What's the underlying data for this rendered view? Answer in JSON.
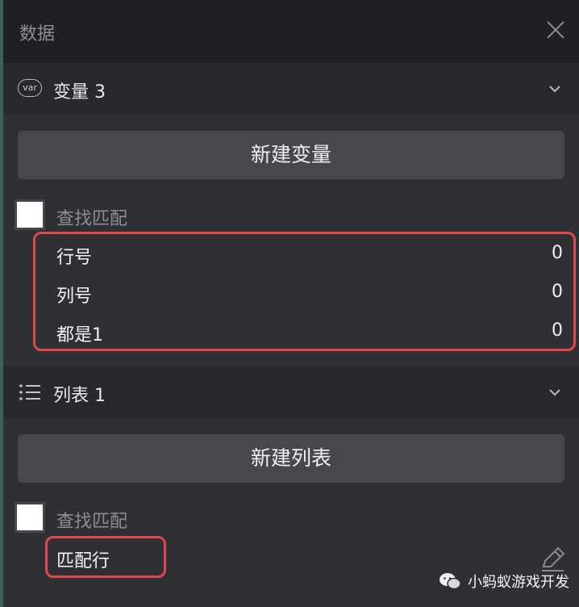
{
  "panel": {
    "title": "数据",
    "close_icon": "close-icon"
  },
  "variables": {
    "header_icon": "var",
    "header_label": "变量 3",
    "new_button": "新建变量",
    "find_match_label": "查找匹配",
    "items": [
      {
        "name": "行号",
        "value": "0"
      },
      {
        "name": "列号",
        "value": "0"
      },
      {
        "name": "都是1",
        "value": "0"
      }
    ]
  },
  "lists": {
    "header_label": "列表 1",
    "new_button": "新建列表",
    "find_match_label": "查找匹配",
    "items": [
      {
        "name": "匹配行"
      }
    ]
  },
  "watermark": {
    "text": "小蚂蚁游戏开发"
  },
  "colors": {
    "highlight_border": "#e0484c",
    "panel_bg": "#2f3034",
    "button_bg": "#47484d"
  }
}
